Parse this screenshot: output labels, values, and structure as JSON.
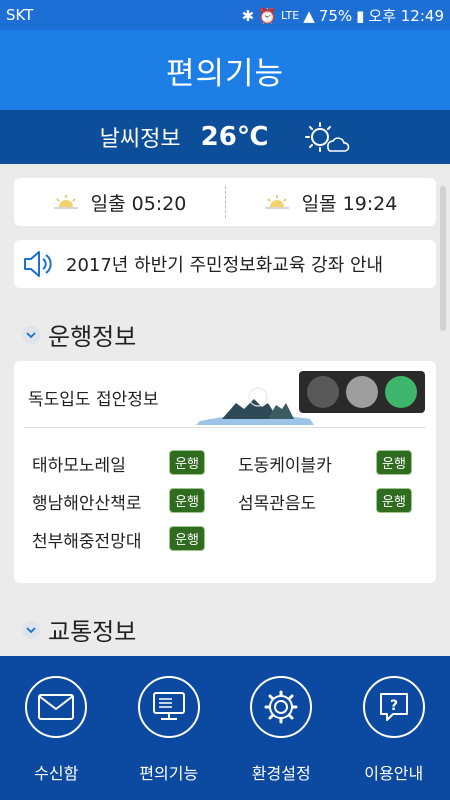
{
  "status_bar": {
    "carrier": "SKT",
    "network": "LTE",
    "battery": "75%",
    "time": "오후 12:49"
  },
  "header": {
    "title": "편의기능"
  },
  "weather": {
    "label": "날씨정보",
    "temperature": "26℃",
    "icon": "sun-cloud-icon"
  },
  "sun_times": {
    "sunrise": "일출 05:20",
    "sunset": "일몰 19:24"
  },
  "notice": {
    "text": "2017년 하반기 주민정보화교육 강좌 안내",
    "icon": "speaker-icon"
  },
  "operation": {
    "section_title": "운행정보",
    "dokdo_label": "독도입도 접안정보",
    "traffic_light": {
      "lit": "green",
      "colors": [
        "#595959",
        "#9e9e9e",
        "#3fb56b"
      ]
    },
    "items": [
      {
        "name": "태하모노레일",
        "status": "운행"
      },
      {
        "name": "도동케이블카",
        "status": "운행"
      },
      {
        "name": "행남해안산책로",
        "status": "운행"
      },
      {
        "name": "섬목관음도",
        "status": "운행"
      },
      {
        "name": "천부해중전망대",
        "status": "운행"
      }
    ]
  },
  "traffic": {
    "section_title": "교통정보"
  },
  "bottom_nav": [
    {
      "label": "수신함",
      "icon": "envelope-icon"
    },
    {
      "label": "편의기능",
      "icon": "monitor-icon"
    },
    {
      "label": "환경설정",
      "icon": "gear-icon"
    },
    {
      "label": "이용안내",
      "icon": "help-icon"
    }
  ],
  "colors": {
    "header_blue": "#1d7fe6",
    "weather_navy": "#0d4e9a",
    "nav_navy": "#0b4aa0",
    "badge_green": "#2f6c1f"
  }
}
